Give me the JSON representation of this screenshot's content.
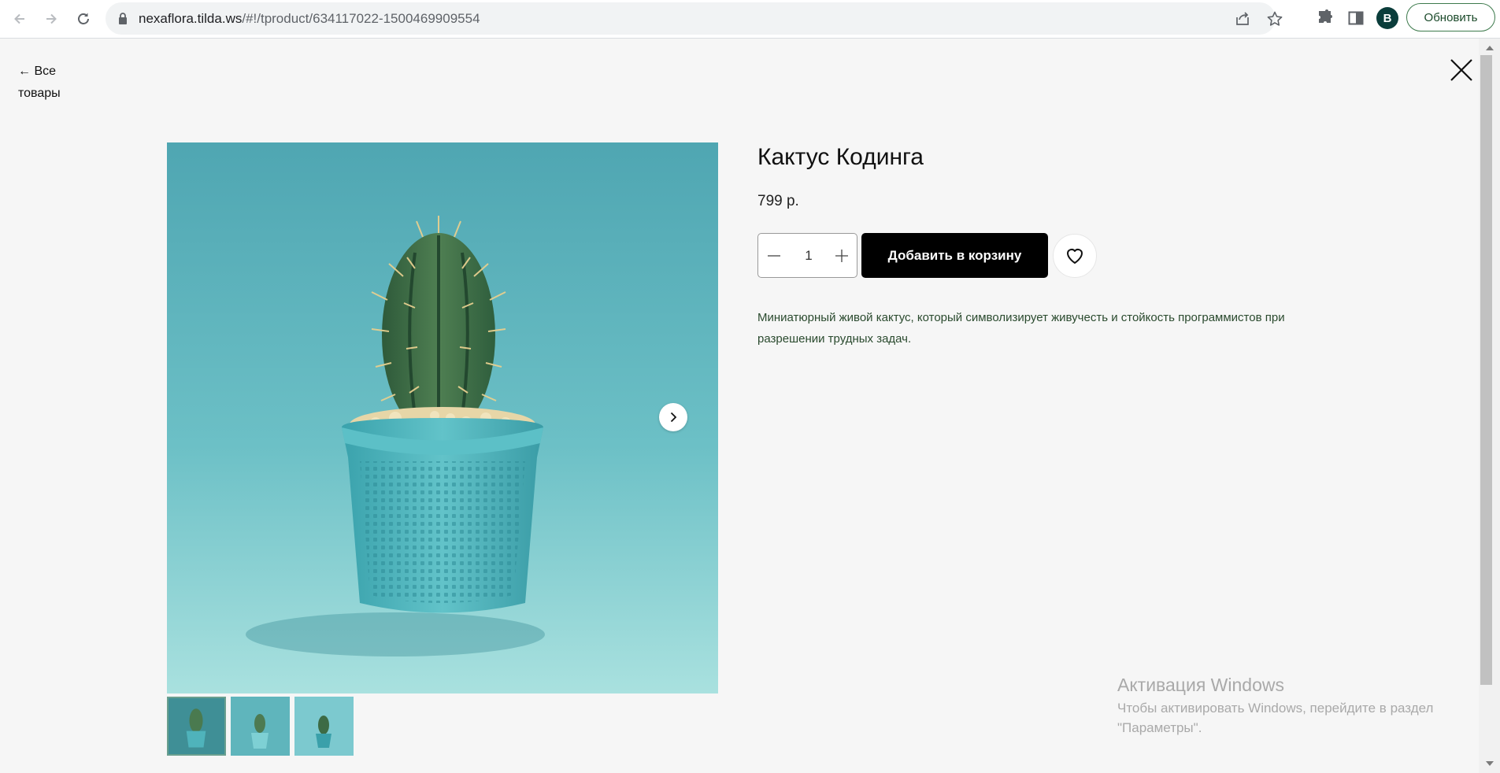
{
  "browser": {
    "url_host": "nexaflora.tilda.ws",
    "url_path": "/#!/tproduct/634117022-1500469909554",
    "profile_initial": "B",
    "update_label": "Обновить"
  },
  "page": {
    "back_link": "← Все товары"
  },
  "product": {
    "title": "Кактус Кодинга",
    "price": "799 р.",
    "quantity": "1",
    "add_to_cart_label": "Добавить в корзину",
    "description": "Миниатюрный живой кактус, который символизирует живучесть и стойкость программистов при разрешении трудных задач.",
    "image_count": 3,
    "active_image_index": 1
  },
  "watermark": {
    "title": "Активация Windows",
    "subtitle": "Чтобы активировать Windows, перейдите в раздел \"Параметры\"."
  },
  "colors": {
    "background": "#f6f6f6",
    "button_primary": "#000000",
    "description_text": "#2a4a2e",
    "image_backdrop": "#5fb2bb",
    "pot": "#4eb3bb"
  },
  "icons": {
    "back": "arrow-left-icon",
    "forward": "arrow-right-icon",
    "reload": "reload-icon",
    "lock": "lock-icon",
    "share": "share-icon",
    "bookmark": "star-icon",
    "extensions": "puzzle-icon",
    "side_panel": "side-panel-icon",
    "close": "close-icon",
    "slider_next": "chevron-right-icon",
    "minus": "minus-icon",
    "plus": "plus-icon",
    "wishlist": "heart-icon"
  }
}
